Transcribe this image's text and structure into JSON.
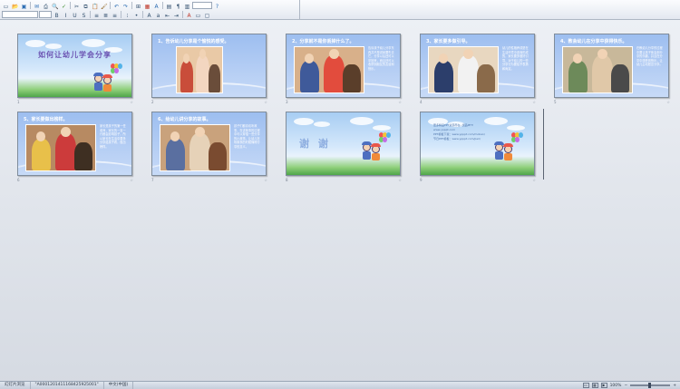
{
  "toolbar": {
    "row1": [
      {
        "glyph": "▭",
        "name": "new-icon",
        "c": ""
      },
      {
        "glyph": "📂",
        "name": "open-icon",
        "c": "c4"
      },
      {
        "glyph": "▣",
        "name": "save-icon",
        "c": "c2"
      },
      {
        "glyph": "✉",
        "name": "email-icon",
        "c": "c2"
      },
      {
        "glyph": "⎙",
        "name": "print-icon",
        "c": ""
      },
      {
        "glyph": "🔍",
        "name": "print-preview-icon",
        "c": ""
      },
      {
        "glyph": "✓",
        "name": "spelling-icon",
        "c": "c3"
      },
      {
        "glyph": "✂",
        "name": "cut-icon",
        "c": ""
      },
      {
        "glyph": "⧉",
        "name": "copy-icon",
        "c": ""
      },
      {
        "glyph": "📋",
        "name": "paste-icon",
        "c": "c4"
      },
      {
        "glyph": "🖌",
        "name": "format-painter-icon",
        "c": "c4"
      },
      {
        "glyph": "↶",
        "name": "undo-icon",
        "c": "c2"
      },
      {
        "glyph": "↷",
        "name": "redo-icon",
        "c": "c2"
      },
      {
        "glyph": "⊞",
        "name": "insert-table-icon",
        "c": ""
      },
      {
        "glyph": "▦",
        "name": "insert-chart-icon",
        "c": "c1"
      },
      {
        "glyph": "A",
        "name": "wordart-icon",
        "c": "c2"
      },
      {
        "glyph": "▤",
        "name": "new-slide-icon",
        "c": ""
      },
      {
        "glyph": "¶",
        "name": "show-formatting-icon",
        "c": ""
      },
      {
        "glyph": "▥",
        "name": "grayscale-icon",
        "c": ""
      },
      {
        "glyph": "?",
        "name": "help-icon",
        "c": "c2"
      }
    ],
    "row2": [
      {
        "glyph": "B",
        "name": "bold-icon",
        "c": ""
      },
      {
        "glyph": "I",
        "name": "italic-icon",
        "c": ""
      },
      {
        "glyph": "U",
        "name": "underline-icon",
        "c": ""
      },
      {
        "glyph": "S",
        "name": "shadow-icon",
        "c": ""
      },
      {
        "glyph": "≡",
        "name": "align-left-icon",
        "c": ""
      },
      {
        "glyph": "≣",
        "name": "align-center-icon",
        "c": ""
      },
      {
        "glyph": "≡",
        "name": "align-right-icon",
        "c": ""
      },
      {
        "glyph": "⁝",
        "name": "numbering-icon",
        "c": ""
      },
      {
        "glyph": "•",
        "name": "bullets-icon",
        "c": ""
      },
      {
        "glyph": "A",
        "name": "increase-font-icon",
        "c": ""
      },
      {
        "glyph": "a",
        "name": "decrease-font-icon",
        "c": ""
      },
      {
        "glyph": "⇤",
        "name": "decrease-indent-icon",
        "c": ""
      },
      {
        "glyph": "⇥",
        "name": "increase-indent-icon",
        "c": ""
      },
      {
        "glyph": "A",
        "name": "font-color-icon",
        "c": "c1"
      },
      {
        "glyph": "▭",
        "name": "design-icon",
        "c": ""
      },
      {
        "glyph": "▢",
        "name": "new-slide-small-icon",
        "c": ""
      }
    ]
  },
  "slides": [
    {
      "num": "1",
      "kind": "cover",
      "title": "如何让幼儿学会分享"
    },
    {
      "num": "2",
      "kind": "photo-left",
      "title": "1、告诉幼儿分享是个愉悦的感受。",
      "body": ""
    },
    {
      "num": "3",
      "kind": "photo-left",
      "title": "2、分享就不是你丢掉什么了。",
      "body": "告诉孩子幼儿分享东西并不是说就要失去它，分享以后还可以拿回来，而且还可以收获到朋友的友谊和快乐。"
    },
    {
      "num": "4",
      "kind": "photo-left",
      "title": "3、家长要多做引导。",
      "body": "幼儿的性格养成是在生活环境中逐渐形成的，家长要多做好引导，对于幼儿的一些分享行为要给予表扬和肯定。"
    },
    {
      "num": "5",
      "kind": "photo-left",
      "title": "4、教会幼儿在分享中获得快乐。",
      "body": "在教幼儿分享的过程中要让孩子体会到分享的乐趣，并且在分享中感受到快乐，让幼儿主动愿意分享。"
    },
    {
      "num": "6",
      "kind": "photo-left",
      "title": "5、家长要做出榜样。",
      "body": "家长是孩子的第一任老师，家长的一言一行都会影响孩子，所以家长在生活中要多分享给孩子看，做出榜样。"
    },
    {
      "num": "7",
      "kind": "photo-left",
      "title": "6、给幼儿讲分享的故事。",
      "body": "孩子们都喜欢听故事，在讲故事的过程中可以穿插一些分享的小故事，让幼儿在听故事的时候懂得分享的意义。"
    },
    {
      "num": "8",
      "kind": "thanks",
      "title": "谢 谢"
    },
    {
      "num": "9",
      "kind": "ending",
      "lines": [
        "更多精品PPT资源尽在--优品PPT!",
        "www.ypppt.com",
        "PPT模板下载：www.ypppt.com/moban/",
        "节日PPT模板：www.ypppt.com/jieri/"
      ]
    }
  ],
  "statusbar": {
    "view": "幻灯片浏览",
    "design": "\"A0001201411168425925001\"",
    "language": "中文(中国)",
    "zoom": "100%"
  },
  "colors": {
    "slide_bg": "#9dbef0",
    "title_purple": "#6b53b2",
    "thanks_blue": "#8eaee0"
  }
}
